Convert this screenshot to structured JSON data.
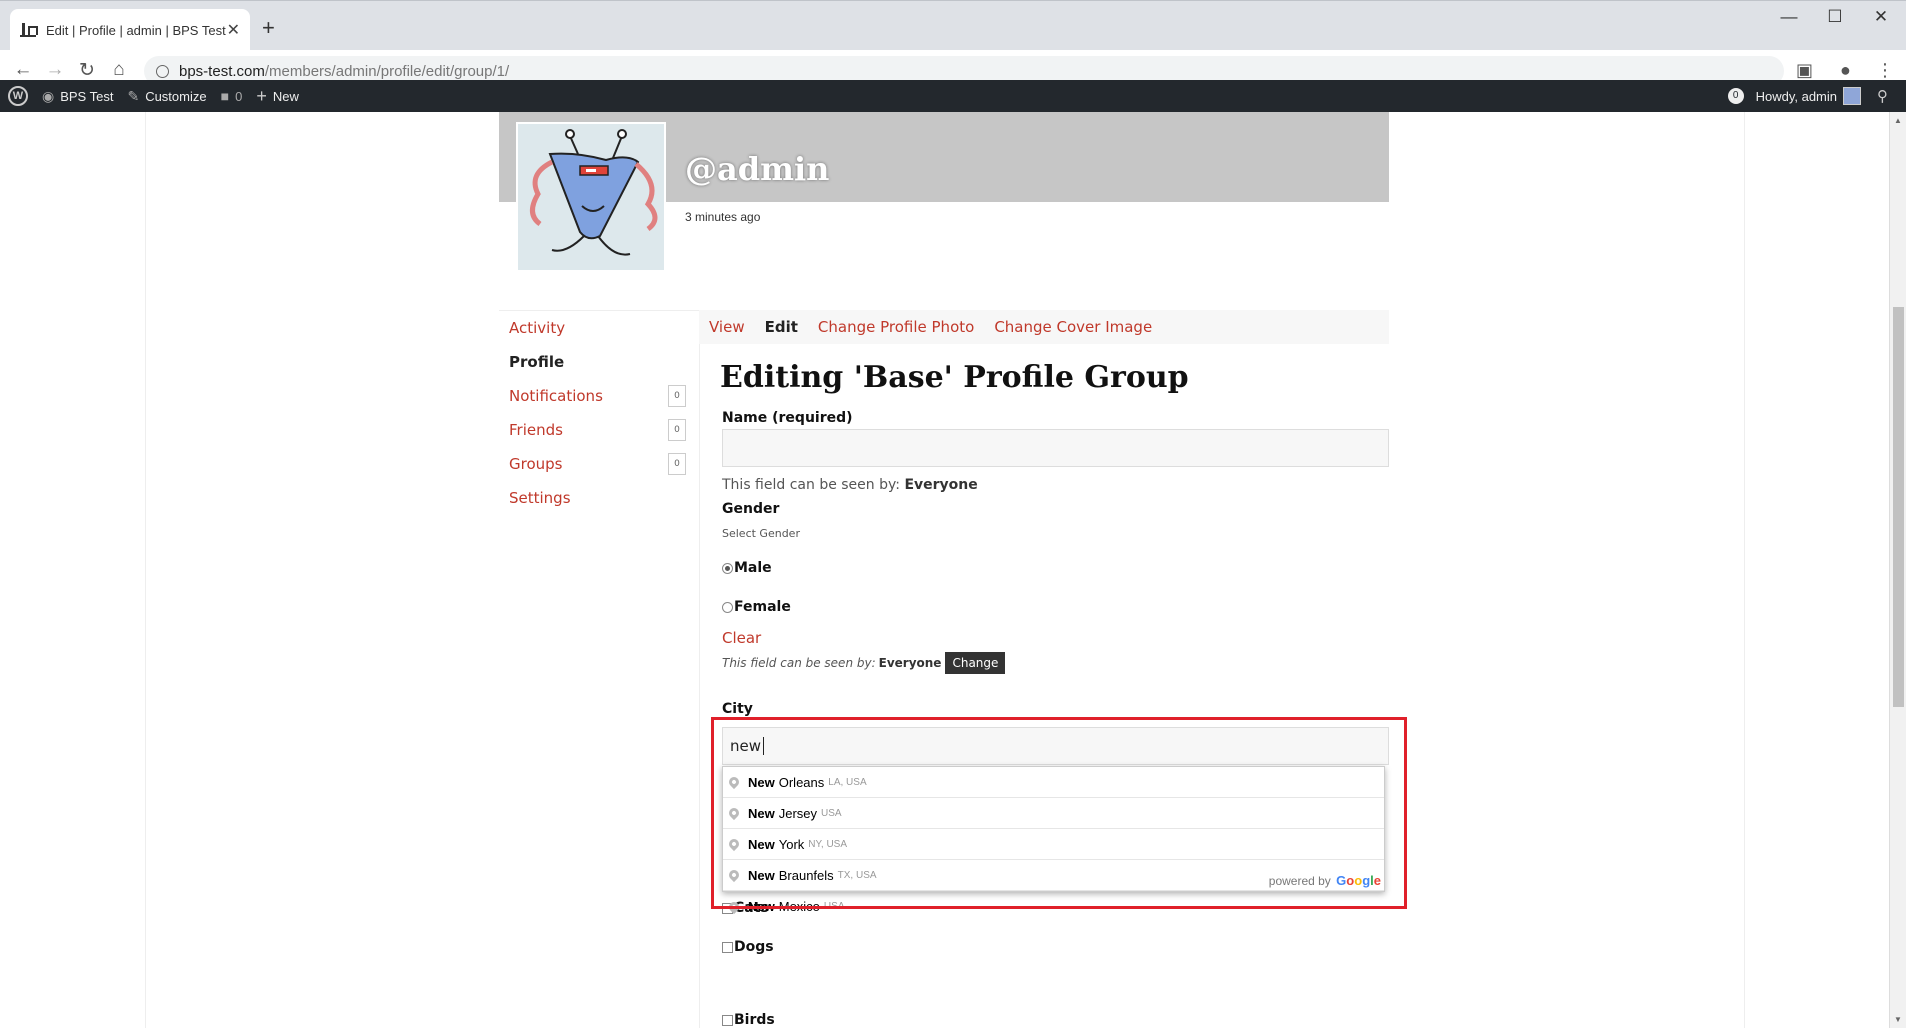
{
  "browser": {
    "tab_title": "Edit | Profile | admin | BPS Test",
    "url_host": "bps-test.com",
    "url_path": "/members/admin/profile/edit/group/1/"
  },
  "adminbar": {
    "site_name": "BPS Test",
    "customize": "Customize",
    "comments_count": "0",
    "new_label": "New",
    "notif_count": "0",
    "howdy": "Howdy, admin"
  },
  "profile": {
    "handle": "@admin",
    "last_active": "3 minutes ago"
  },
  "side_nav": [
    {
      "label": "Activity",
      "count": null
    },
    {
      "label": "Profile",
      "count": null
    },
    {
      "label": "Notifications",
      "count": "0"
    },
    {
      "label": "Friends",
      "count": "0"
    },
    {
      "label": "Groups",
      "count": "0"
    },
    {
      "label": "Settings",
      "count": null
    }
  ],
  "sub_nav": [
    "View",
    "Edit",
    "Change Profile Photo",
    "Change Cover Image"
  ],
  "form": {
    "title": "Editing 'Base' Profile Group",
    "name_label": "Name (required)",
    "name_value": "",
    "vis_prefix": "This field can be seen by:",
    "vis_value": "Everyone",
    "gender_label": "Gender",
    "gender_desc": "Select Gender",
    "gender_options": [
      "Male",
      "Female"
    ],
    "gender_selected": "Male",
    "clear_label": "Clear",
    "change_label": "Change",
    "city_label": "City",
    "city_value": "new",
    "pets": [
      "Cats",
      "Dogs",
      "Birds"
    ]
  },
  "autocomplete": {
    "items": [
      {
        "match": "New",
        "rest": "Orleans",
        "secondary": "LA, USA"
      },
      {
        "match": "New",
        "rest": "Jersey",
        "secondary": "USA"
      },
      {
        "match": "New",
        "rest": "York",
        "secondary": "NY, USA"
      },
      {
        "match": "New",
        "rest": "Braunfels",
        "secondary": "TX, USA"
      },
      {
        "match": "New",
        "rest": "Mexico",
        "secondary": "USA"
      }
    ],
    "powered_by": "powered by",
    "google_letters": [
      "G",
      "o",
      "o",
      "g",
      "l",
      "e"
    ]
  },
  "colors": {
    "link": "#c0392b",
    "adminbar": "#23282d",
    "highlight": "#e0202a"
  }
}
